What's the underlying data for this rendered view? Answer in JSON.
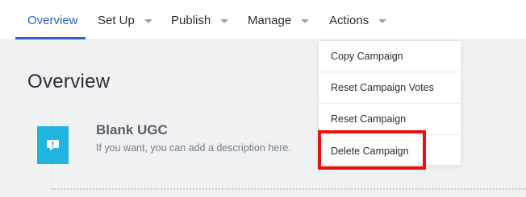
{
  "nav": {
    "items": [
      {
        "label": "Overview",
        "has_caret": false,
        "active": true
      },
      {
        "label": "Set Up",
        "has_caret": true,
        "active": false
      },
      {
        "label": "Publish",
        "has_caret": true,
        "active": false
      },
      {
        "label": "Manage",
        "has_caret": true,
        "active": false
      },
      {
        "label": "Actions",
        "has_caret": true,
        "active": false
      }
    ]
  },
  "page": {
    "title": "Overview"
  },
  "campaign": {
    "title": "Blank UGC",
    "description": "If you want, you can add a description here.",
    "icon": "chat-bubble-exclamation-icon"
  },
  "actions_menu": {
    "items": [
      {
        "label": "Copy Campaign"
      },
      {
        "label": "Reset Campaign Votes"
      },
      {
        "label": "Reset Campaign"
      },
      {
        "label": "Delete Campaign"
      }
    ],
    "highlighted_item": "Delete Campaign"
  },
  "colors": {
    "accent": "#2f63c8",
    "icon_bg": "#1fb5e0",
    "highlight": "#e8110f",
    "background": "#f0f1f3"
  }
}
